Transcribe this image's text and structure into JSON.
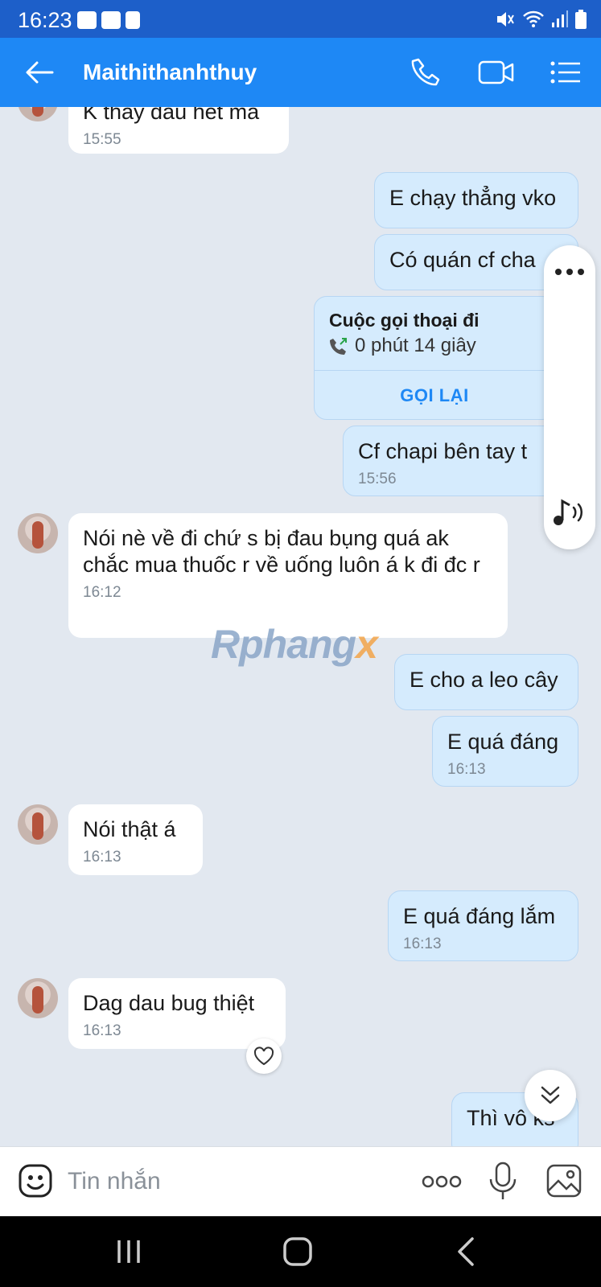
{
  "status_bar": {
    "time": "16:23"
  },
  "header": {
    "contact_name": "Maithithanhthuy"
  },
  "messages": [
    {
      "text": "K thay dau het ma",
      "time": "15:55"
    },
    {
      "text": "E chạy thẳng vko"
    },
    {
      "text": "Có quán cf cha"
    },
    {
      "call_title": "Cuộc gọi thoại đi",
      "call_duration": "0 phút 14 giây",
      "call_action": "GỌI LẠI"
    },
    {
      "text": "Cf chapi bên tay t",
      "time": "15:56"
    },
    {
      "text": "Nói nè về đi chứ s bị đau bụng quá ak chắc mua thuốc r về uống luôn á k đi đc r",
      "time": "16:12"
    },
    {
      "text": "E cho a leo cây"
    },
    {
      "text": "E quá đáng",
      "time": "16:13"
    },
    {
      "text": "Nói thật á",
      "time": "16:13"
    },
    {
      "text": "E quá đáng lắm",
      "time": "16:13"
    },
    {
      "text": "Dag dau bug thiệt",
      "time": "16:13"
    },
    {
      "text": "Thì vô ks"
    }
  ],
  "watermark": {
    "main": "Rphang",
    "accent": "x"
  },
  "composer": {
    "placeholder": "Tin nhắn"
  },
  "colors": {
    "header": "#1e88f5",
    "status_bar": "#1d5fc9",
    "outgoing": "#d5ebfd",
    "incoming": "#ffffff",
    "background": "#e2e8f0"
  }
}
